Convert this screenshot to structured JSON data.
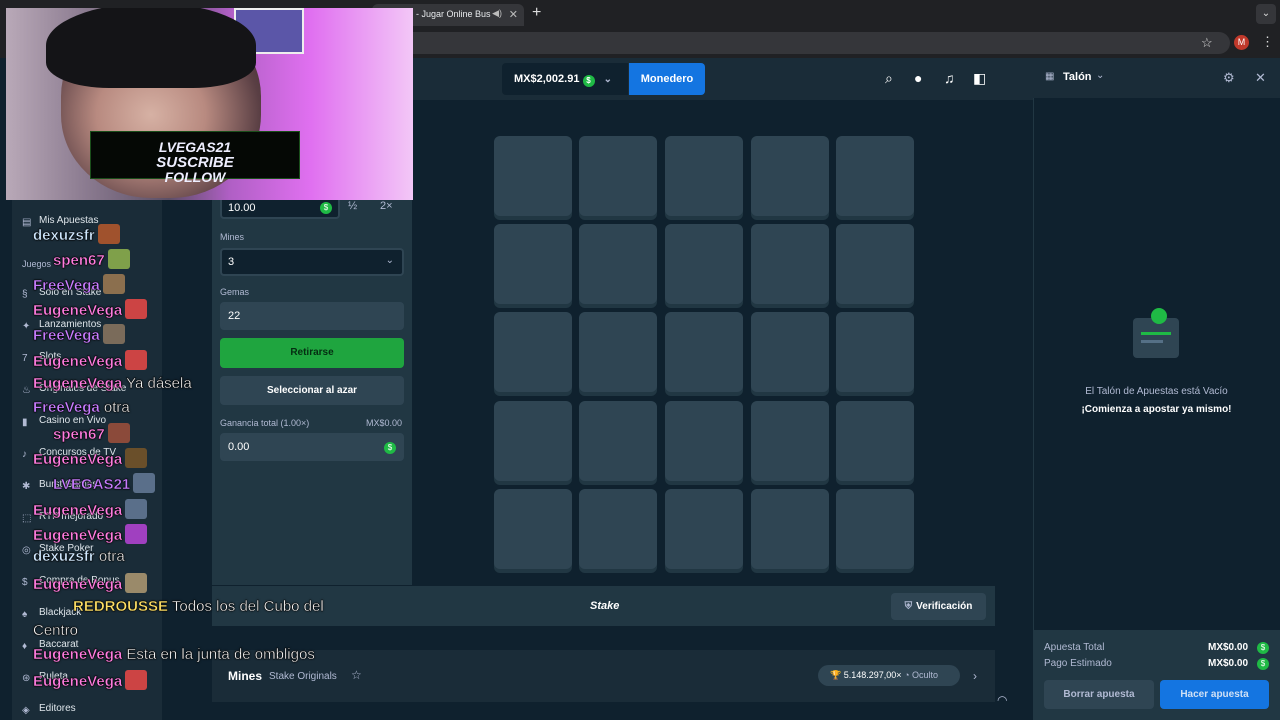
{
  "browser": {
    "tab_title": "- Jugar Online Bus",
    "new_tab": "+",
    "profile_initial": "M"
  },
  "header": {
    "balance": "MX$2,002.91",
    "wallet_button": "Monedero"
  },
  "sidebar": {
    "my_bets": "Mis Apuestas",
    "games_heading": "Juegos",
    "items": [
      "Solo en Stake",
      "Lanzamientos",
      "Slots",
      "Originales de Stake",
      "Casino en Vivo",
      "Concursos de TV",
      "Burst Games",
      "RTP mejorado",
      "Stake Poker",
      "Compra de Bonus",
      "Blackjack",
      "Baccarat",
      "Ruleta",
      "Editores"
    ]
  },
  "controls": {
    "bet_amount": "10.00",
    "half": "½",
    "double": "2×",
    "mines_label": "Mines",
    "mines_value": "3",
    "gems_label": "Gemas",
    "gems_value": "22",
    "cashout_button": "Retirarse",
    "random_button": "Seleccionar al azar",
    "profit_label": "Ganancia total (1.00×)",
    "profit_amount": "MX$0.00",
    "profit_value": "0.00"
  },
  "grid": {
    "rows": 5,
    "cols": 5
  },
  "footer": {
    "logo": "Stake",
    "verify_button": "Verificación"
  },
  "game_info": {
    "title": "Mines",
    "subtitle": "Stake Originals",
    "max_win": "5.148.297,00×",
    "visibility": "Oculto"
  },
  "betslip": {
    "title": "Talón",
    "empty_title": "El Talón de Apuestas está Vacío",
    "empty_cta": "¡Comienza a apostar ya mismo!",
    "total_bet_label": "Apuesta Total",
    "total_bet_value": "MX$0.00",
    "est_payout_label": "Pago Estimado",
    "est_payout_value": "MX$0.00",
    "clear_button": "Borrar apuesta",
    "place_button": "Hacer apuesta"
  },
  "webcam": {
    "banner_line1": "LVEGAS21",
    "banner_line2": "SUSCRIBE",
    "banner_line3": "FOLLOW"
  },
  "chat": [
    {
      "user": "dexuzsfr",
      "color": "#cfe8ff",
      "msg": ""
    },
    {
      "user": "spen67",
      "color": "#ff7de0",
      "msg": ""
    },
    {
      "user": "FreeVega",
      "color": "#c77dff",
      "msg": ""
    },
    {
      "user": "EugeneVega",
      "color": "#ff7de0",
      "msg": ""
    },
    {
      "user": "FreeVega",
      "color": "#c77dff",
      "msg": ""
    },
    {
      "user": "EugeneVega",
      "color": "#ff7de0",
      "msg": ""
    },
    {
      "user": "EugeneVega",
      "color": "#ff7de0",
      "msg": "Ya dásela"
    },
    {
      "user": "FreeVega",
      "color": "#c77dff",
      "msg": "otra"
    },
    {
      "user": "spen67",
      "color": "#ff7de0",
      "msg": ""
    },
    {
      "user": "EugeneVega",
      "color": "#ff7de0",
      "msg": ""
    },
    {
      "user": "LVEGAS21",
      "color": "#c77dff",
      "msg": ""
    },
    {
      "user": "EugeneVega",
      "color": "#ff7de0",
      "msg": ""
    },
    {
      "user": "EugeneVega",
      "color": "#ff7de0",
      "msg": ""
    },
    {
      "user": "dexuzsfr",
      "color": "#cfe8ff",
      "msg": "otra"
    },
    {
      "user": "EugeneVega",
      "color": "#ff7de0",
      "msg": ""
    },
    {
      "user": "REDROUSSE",
      "color": "#ffe066",
      "msg": "Todos los del Cubo del"
    },
    {
      "user": "",
      "color": "#ffffff",
      "msg": "Centro"
    },
    {
      "user": "EugeneVega",
      "color": "#ff7de0",
      "msg": "Esta en la junta de ombligos"
    },
    {
      "user": "EugeneVega",
      "color": "#ff7de0",
      "msg": ""
    }
  ],
  "colors": {
    "accent_blue": "#1475e1",
    "cashout_green": "#1fa53f",
    "bg_dark": "#0f212e",
    "panel": "#213743",
    "tile": "#2f4553"
  }
}
